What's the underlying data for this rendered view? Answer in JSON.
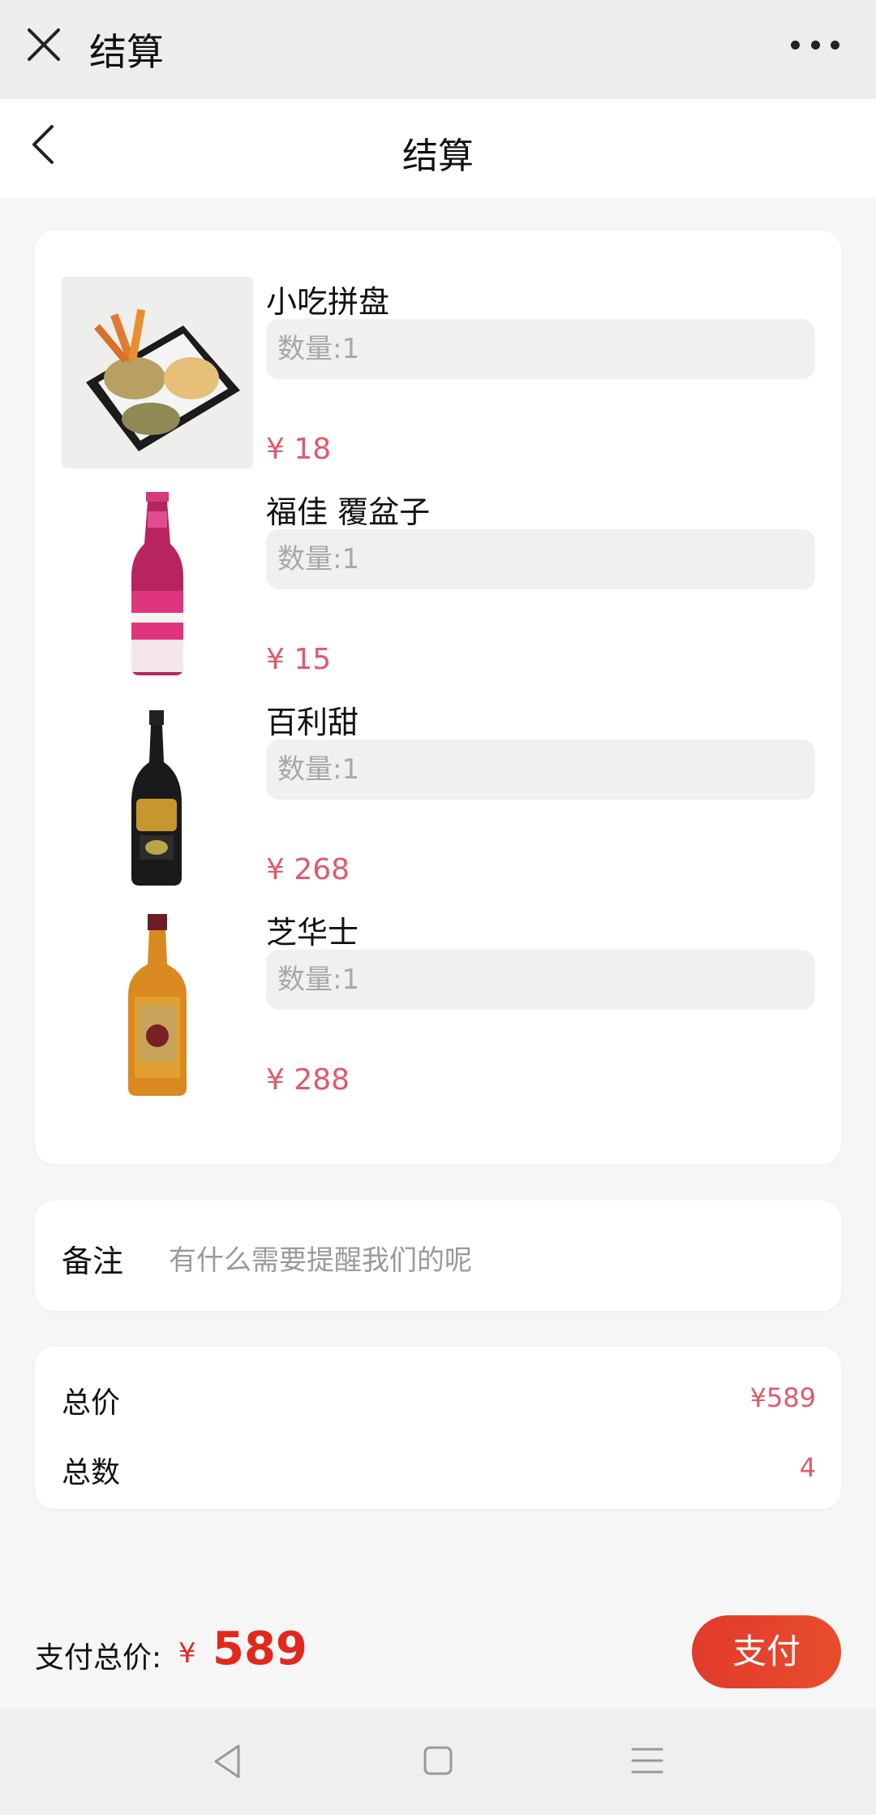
{
  "top_bar": {
    "title": "结算"
  },
  "nav": {
    "title": "结算"
  },
  "items": [
    {
      "name": "小吃拼盘",
      "qty": "数量:1",
      "price": "¥ 18"
    },
    {
      "name": "福佳 覆盆子",
      "qty": "数量:1",
      "price": "¥ 15"
    },
    {
      "name": "百利甜",
      "qty": "数量:1",
      "price": "¥ 268"
    },
    {
      "name": "芝华士",
      "qty": "数量:1",
      "price": "¥ 288"
    }
  ],
  "remark": {
    "label": "备注",
    "placeholder": "有什么需要提醒我们的呢"
  },
  "summary": {
    "total_label": "总价",
    "total_value": "¥589",
    "count_label": "总数",
    "count_value": "4"
  },
  "paybar": {
    "label": "支付总价:",
    "currency": "¥",
    "total": "589",
    "button": "支付"
  },
  "colors": {
    "price": "#e05a6a",
    "accent": "#e0291c",
    "button": "#e33b2c"
  },
  "icons": [
    "close-icon",
    "more-icon",
    "back-icon",
    "nav-back-icon",
    "nav-home-icon",
    "nav-menu-icon"
  ]
}
